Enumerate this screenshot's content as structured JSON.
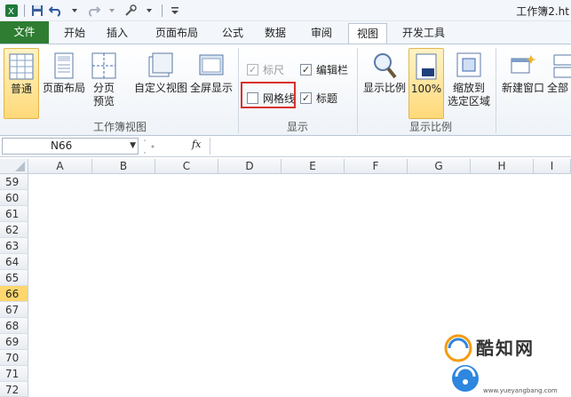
{
  "window": {
    "title": "工作簿2.ht"
  },
  "tabs": {
    "file": "文件",
    "items": [
      "开始",
      "插入",
      "页面布局",
      "公式",
      "数据",
      "审阅",
      "视图",
      "开发工具"
    ],
    "active": "视图"
  },
  "ribbon": {
    "workbook_views": {
      "label": "工作簿视图",
      "normal": "普通",
      "page_layout": "页面布局",
      "page_break_1": "分页",
      "page_break_2": "预览",
      "custom": "自定义视图",
      "fullscreen": "全屏显示"
    },
    "show": {
      "label": "显示",
      "ruler": "标尺",
      "formula_bar": "编辑栏",
      "gridlines": "网格线",
      "headings": "标题"
    },
    "zoom": {
      "label": "显示比例",
      "zoom": "显示比例",
      "hundred": "100%",
      "zoom_sel_1": "缩放到",
      "zoom_sel_2": "选定区域"
    },
    "window": {
      "new_window": "新建窗口",
      "arrange": "全部"
    }
  },
  "formula_bar": {
    "name_box": "N66",
    "fx": "fx"
  },
  "grid": {
    "columns": [
      "A",
      "B",
      "C",
      "D",
      "E",
      "F",
      "G",
      "H",
      "I"
    ],
    "rows": [
      "59",
      "60",
      "61",
      "62",
      "63",
      "64",
      "65",
      "66",
      "67",
      "68",
      "69",
      "70",
      "71",
      "72"
    ],
    "selected_row": "66"
  },
  "watermark": {
    "text": "酷知网",
    "site": "www.yueyangbang.com"
  },
  "colors": {
    "file_tab": "#2e7d32",
    "highlight": "#d9302c",
    "selected_row": "#ffd76e"
  }
}
